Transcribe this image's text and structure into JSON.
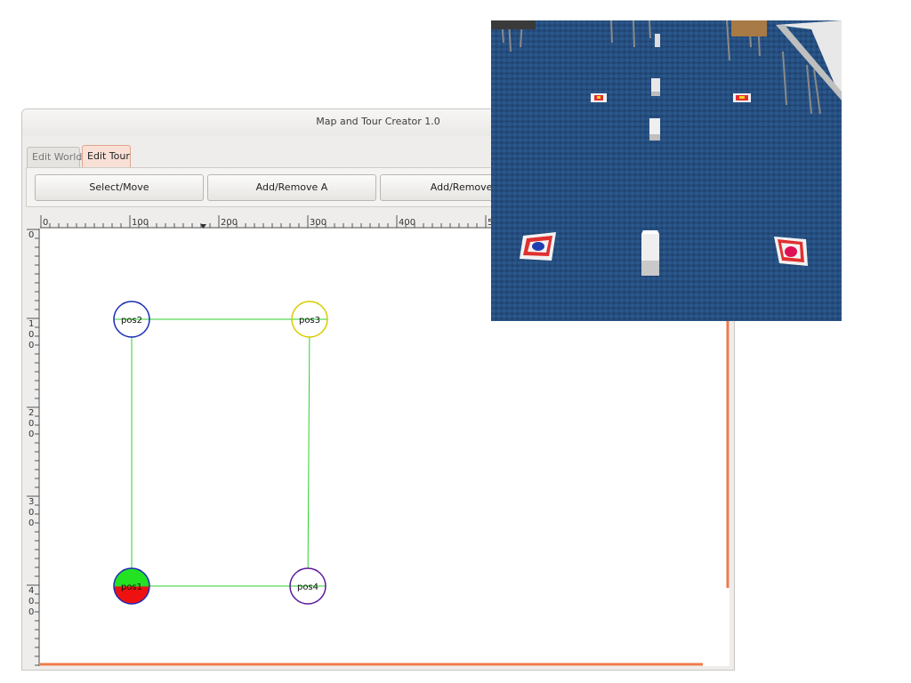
{
  "window": {
    "title": "Map and Tour Creator 1.0"
  },
  "tabs": [
    {
      "label": "Edit World",
      "active": false
    },
    {
      "label": "Edit Tour",
      "active": true
    }
  ],
  "toolbar": {
    "buttons": [
      "Select/Move",
      "Add/Remove A",
      "Add/Remove I"
    ]
  },
  "ruler": {
    "horizontal_labels": [
      "0",
      "100",
      "200",
      "300",
      "400",
      "5"
    ],
    "vertical_labels": [
      "0",
      "100",
      "200",
      "300",
      "400"
    ]
  },
  "tour": {
    "nodes": [
      {
        "label": "pos1",
        "ring_color": "#1a2db5",
        "fill_top": "#22e222",
        "fill_bottom": "#ee1111"
      },
      {
        "label": "pos2",
        "ring_color": "#1a2db5",
        "fill_top": "#ffffff",
        "fill_bottom": "#ffffff"
      },
      {
        "label": "pos3",
        "ring_color": "#d8cc00",
        "fill_top": "#ffffff",
        "fill_bottom": "#ffffff"
      },
      {
        "label": "pos4",
        "ring_color": "#5a1a9a",
        "fill_top": "#ffffff",
        "fill_bottom": "#ffffff"
      }
    ],
    "edges": [
      [
        "pos2",
        "pos3"
      ],
      [
        "pos2",
        "pos1"
      ],
      [
        "pos3",
        "pos4"
      ],
      [
        "pos1",
        "pos4"
      ]
    ],
    "edge_color": "#2ed12e",
    "boundary_color": "#ee7a4a"
  },
  "overlay_photo": {
    "description_icon": "camera-photo"
  }
}
